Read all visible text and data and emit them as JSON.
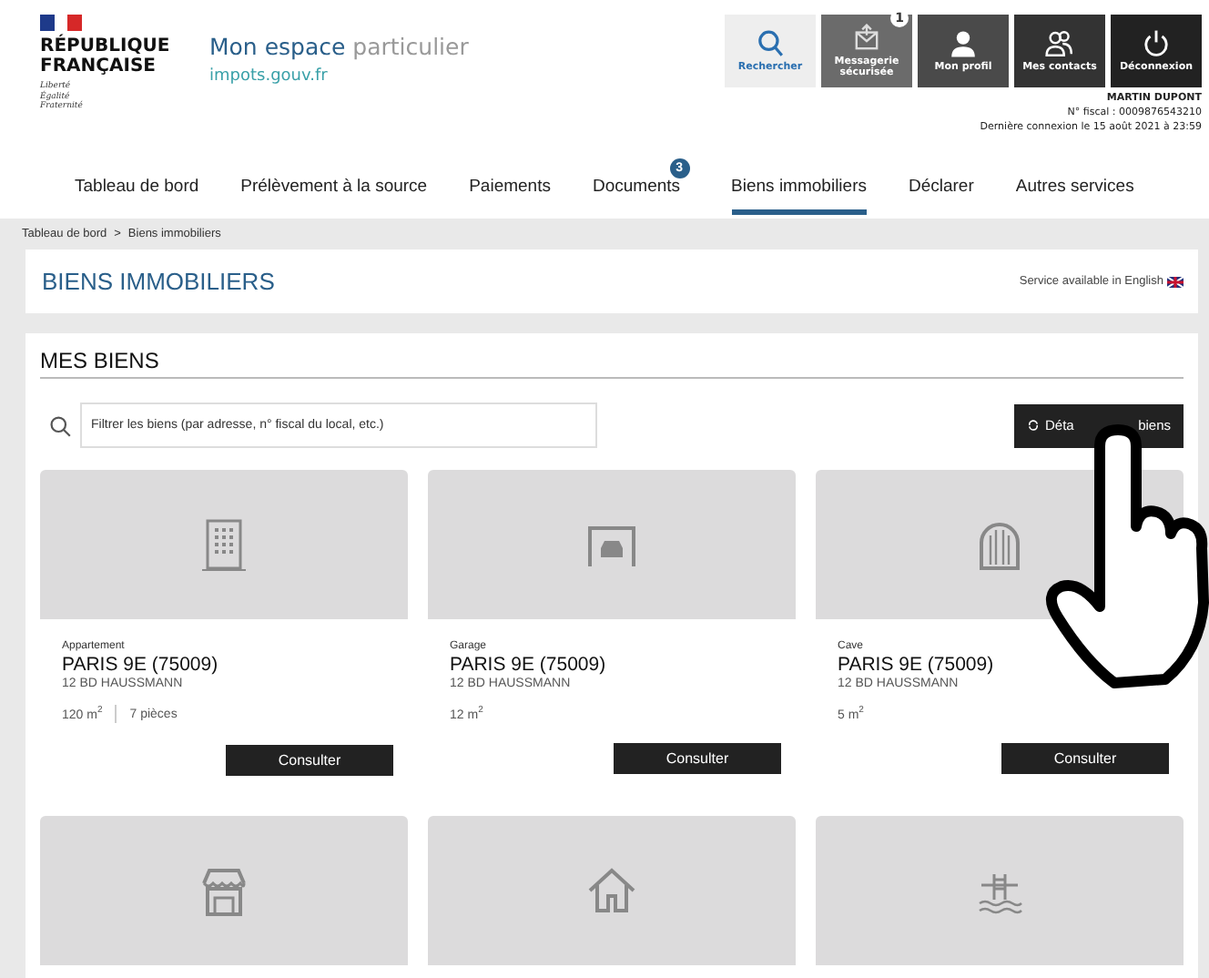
{
  "header": {
    "logo": {
      "lines": [
        "RÉPUBLIQUE",
        "FRANÇAISE"
      ],
      "motto": [
        "Liberté",
        "Égalité",
        "Fraternité"
      ]
    },
    "site_title": {
      "strong": "Mon espace",
      "rest": "particulier"
    },
    "site_domain": "impots.gouv.fr",
    "tools": [
      {
        "kind": "search",
        "label": "Rechercher"
      },
      {
        "kind": "mail",
        "label": "Messagerie sécurisée",
        "badge": "1"
      },
      {
        "kind": "profile",
        "label": "Mon profil"
      },
      {
        "kind": "contacts",
        "label": "Mes contacts"
      },
      {
        "kind": "logout",
        "label": "Déconnexion"
      }
    ],
    "user": {
      "name": "MARTIN DUPONT",
      "fiscal_number": "N° fiscal : 0009876543210",
      "last_login": "Dernière connexion le 15 août 2021 à 23:59"
    }
  },
  "nav": [
    {
      "label": "Tableau de bord",
      "selected": false
    },
    {
      "label": "Prélèvement à la source",
      "selected": false
    },
    {
      "label": "Paiements",
      "selected": false
    },
    {
      "label": "Documents",
      "selected": false,
      "badge": "3"
    },
    {
      "label": "Biens immobiliers",
      "selected": true
    },
    {
      "label": "Déclarer",
      "selected": false
    },
    {
      "label": "Autres services",
      "selected": false
    }
  ],
  "breadcrumb": {
    "items": [
      "Tableau de bord",
      "Biens immobiliers"
    ],
    "separator": ">"
  },
  "page_title": "BIENS IMMOBILIERS",
  "language_link": "Service available in English",
  "section": {
    "title": "MES BIENS",
    "filter": {
      "placeholder": "Filtrer les biens (par adresse, n° fiscal du local, etc.)"
    },
    "details_button": {
      "label_start": "Déta",
      "label_end": "biens"
    },
    "cards": [
      {
        "kind": "apartment",
        "type": "Appartement",
        "city": "PARIS 9E (75009)",
        "address": "12 BD HAUSSMANN",
        "surface": "120 m$^{2}$",
        "rooms": "7 pièces",
        "button": "Consulter"
      },
      {
        "kind": "garage",
        "type": "Garage",
        "city": "PARIS 9E (75009)",
        "address": "12 BD HAUSSMANN",
        "surface": "12 m$^{2}$",
        "button": "Consulter"
      },
      {
        "kind": "cellar",
        "type": "Cave",
        "city": "PARIS 9E (75009)",
        "address": "12 BD HAUSSMANN",
        "surface": "5 m$^{2}$",
        "button": "Consulter"
      },
      {
        "kind": "shop"
      },
      {
        "kind": "house"
      },
      {
        "kind": "pool"
      }
    ]
  }
}
